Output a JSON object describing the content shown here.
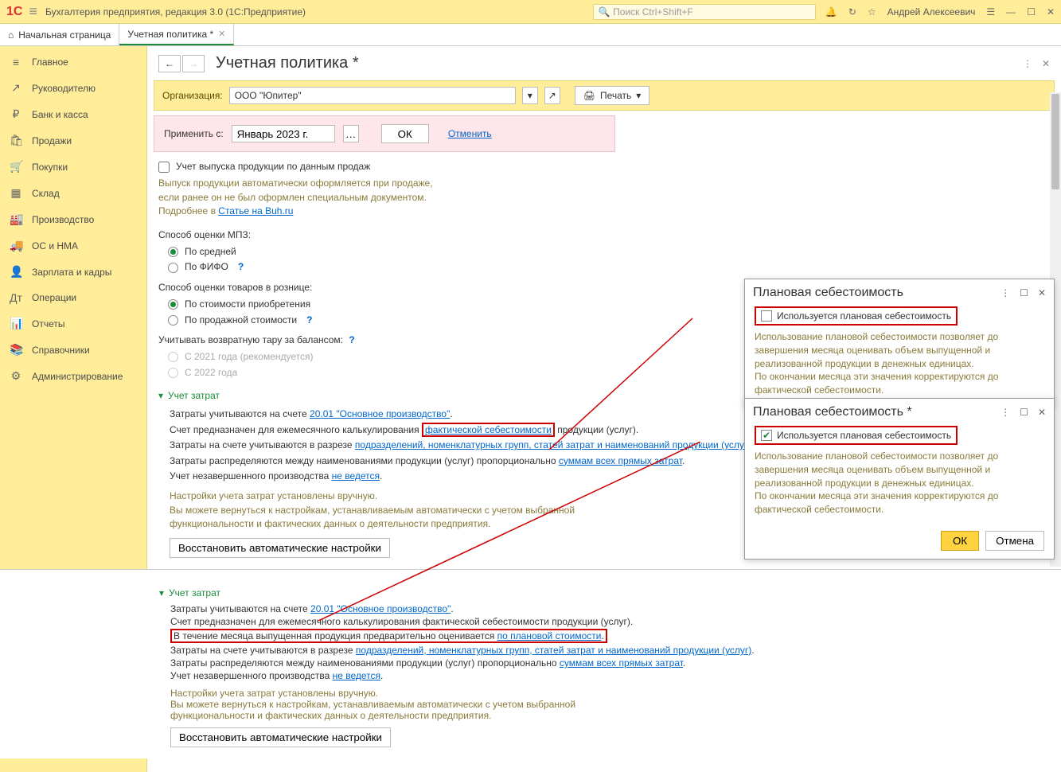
{
  "titlebar": {
    "app_title": "Бухгалтерия предприятия, редакция 3.0  (1С:Предприятие)",
    "search_placeholder": "Поиск Ctrl+Shift+F",
    "user": "Андрей Алексеевич"
  },
  "tabs": {
    "home": "Начальная страница",
    "active": "Учетная политика *"
  },
  "sidebar": [
    {
      "icon": "≡",
      "label": "Главное"
    },
    {
      "icon": "↗",
      "label": "Руководителю"
    },
    {
      "icon": "₽",
      "label": "Банк и касса"
    },
    {
      "icon": "🛍",
      "label": "Продажи"
    },
    {
      "icon": "🛒",
      "label": "Покупки"
    },
    {
      "icon": "▦",
      "label": "Склад"
    },
    {
      "icon": "🏭",
      "label": "Производство"
    },
    {
      "icon": "🚚",
      "label": "ОС и НМА"
    },
    {
      "icon": "👤",
      "label": "Зарплата и кадры"
    },
    {
      "icon": "Дт",
      "label": "Операции"
    },
    {
      "icon": "📊",
      "label": "Отчеты"
    },
    {
      "icon": "📚",
      "label": "Справочники"
    },
    {
      "icon": "⚙",
      "label": "Администрирование"
    }
  ],
  "page": {
    "title": "Учетная политика *",
    "org_label": "Организация:",
    "org_value": "ООО \"Юпитер\"",
    "print_btn": "Печать",
    "apply_label": "Применить с:",
    "apply_date": "Январь 2023 г.",
    "ok": "ОК",
    "cancel": "Отменить",
    "chk_release": "Учет выпуска продукции по данным продаж",
    "release_hint1": "Выпуск продукции автоматически оформляется при продаже,",
    "release_hint2": "если ранее он не был оформлен специальным документом.",
    "release_hint3": "Подробнее в ",
    "release_link": "Статье на Buh.ru",
    "mpz_label": "Способ оценки МПЗ:",
    "mpz_r1": "По средней",
    "mpz_r2": "По ФИФО",
    "retail_label": "Способ оценки товаров в рознице:",
    "retail_r1": "По стоимости приобретения",
    "retail_r2": "По продажной стоимости",
    "tara_label": "Учитывать возвратную тару за балансом:",
    "tara_r1": "С 2021 года (рекомендуется)",
    "tara_r2": "С 2022 года",
    "cost_header": "Учет затрат",
    "cost_l1a": "Затраты учитываются на счете ",
    "cost_l1b": "20.01 \"Основное производство\"",
    "cost_l2a": "Счет предназначен для ежемесячного калькулирования ",
    "cost_l2b": "фактической себестоимости",
    "cost_l2c": " продукции (услуг).",
    "cost_l3a": "Затраты на счете учитываются в разрезе ",
    "cost_l3b": "подразделений, номенклатурных групп, статей затрат и наименований продукции (услуг)",
    "cost_l4a": "Затраты распределяются между наименованиями продукции (услуг) пропорционально ",
    "cost_l4b": "суммам всех прямых затрат",
    "cost_l5a": "Учет незавершенного производства ",
    "cost_l5b": "не ведется",
    "cost_hint1": "Настройки учета затрат установлены вручную.",
    "cost_hint2": "Вы можете вернуться к настройкам, устанавливаемым автоматически с учетом выбранной",
    "cost_hint3": "функциональности и фактических данных о деятельности предприятия.",
    "restore_btn": "Восстановить автоматические настройки",
    "cost2_l2": "Счет предназначен для ежемесячного калькулирования фактической себестоимости продукции (услуг).",
    "cost2_l3a": "В течение месяца выпущенная продукция предварительно оценивается ",
    "cost2_l3b": "по плановой стоимости"
  },
  "popup": {
    "title1": "Плановая себестоимость",
    "title2": "Плановая себестоимость *",
    "chk": "Используется плановая себестоимость",
    "hint1": "Использование плановой себестоимости позволяет до завершения месяца оценивать объем выпущенной и реализованной продукции в денежных единицах.",
    "hint2": "По окончании месяца эти значения корректируются до фактической себестоимости.",
    "ok": "ОК",
    "cancel": "Отмена"
  }
}
